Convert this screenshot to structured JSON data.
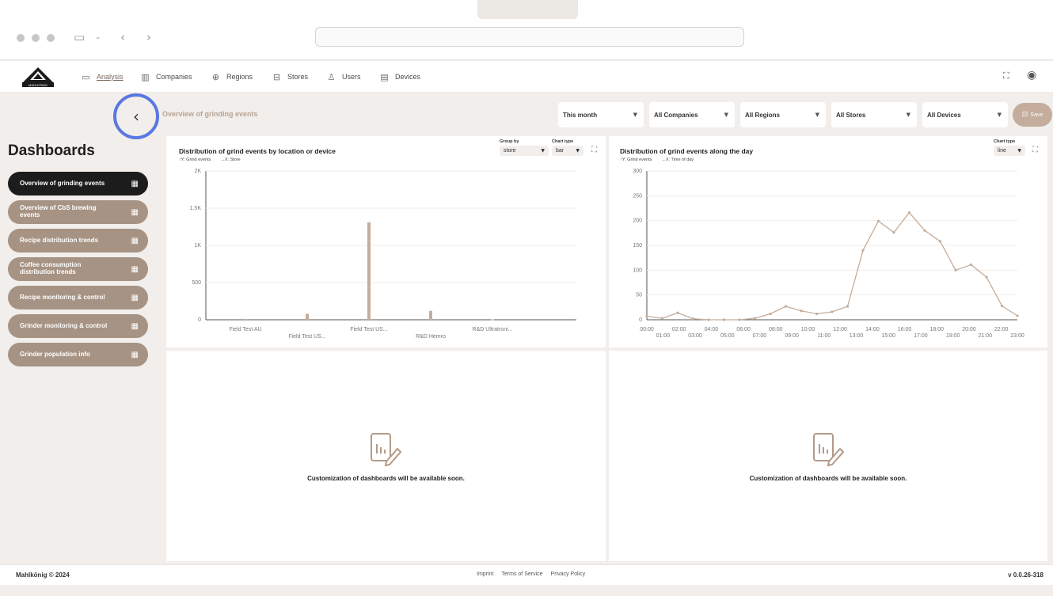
{
  "nav": {
    "logo_text": "MAHLKÖNIG",
    "items": [
      {
        "label": "Analysis",
        "icon": "analysis-icon"
      },
      {
        "label": "Companies",
        "icon": "building-icon"
      },
      {
        "label": "Regions",
        "icon": "globe-icon"
      },
      {
        "label": "Stores",
        "icon": "store-icon"
      },
      {
        "label": "Users",
        "icon": "users-icon"
      },
      {
        "label": "Devices",
        "icon": "device-icon"
      }
    ],
    "active": "Analysis"
  },
  "breadcrumb": "Overview of grinding events",
  "filters": {
    "period": "This month",
    "companies": "All Companies",
    "regions": "All Regions",
    "stores": "All Stores",
    "devices": "All Devices",
    "save_label": "Save"
  },
  "sidebar": {
    "title": "Dashboards",
    "items": [
      {
        "label": "Overview of grinding events",
        "active": true
      },
      {
        "label": "Overview of CbS brewing events"
      },
      {
        "label": "Recipe distribution trends"
      },
      {
        "label": "Coffee consumption distribution trends"
      },
      {
        "label": "Recipe monitoring & control"
      },
      {
        "label": "Grinder monitoring & control"
      },
      {
        "label": "Grinder population info"
      }
    ]
  },
  "panel1": {
    "title": "Distribution of grind events by location or device",
    "legend_y": "↑Y: Grind events",
    "legend_x": "→X: Store",
    "group_by_label": "Group by",
    "group_by_value": "store",
    "chart_type_label": "Chart type",
    "chart_type_value": "bar"
  },
  "panel2": {
    "title": "Distribution of grind events along the day",
    "legend_y": "↑Y: Grind events",
    "legend_x": "→X: Time of day",
    "chart_type_label": "Chart type",
    "chart_type_value": "line"
  },
  "soon_text": "Customization of dashboards will be available soon.",
  "footer": {
    "copyright": "Mahlkönig © 2024",
    "links": [
      "Imprint",
      "Terms of Service",
      "Privacy Policy"
    ],
    "version": "v 0.0.26-318"
  },
  "colors": {
    "accent": "#c4ad9c",
    "sidebar_item": "#a69384",
    "active": "#1c1c1c",
    "highlight_ring": "#5a78e0"
  },
  "chart_data": [
    {
      "type": "bar",
      "categories": [
        "Field Test AU",
        "Field Test US...",
        "Field Test US...",
        "R&D Hemro",
        "R&D Ultratroni..."
      ],
      "values": [
        10,
        80,
        1310,
        120,
        5
      ],
      "yticks": [
        "0",
        "500",
        "1K",
        "1.5K",
        "2K"
      ],
      "ylim": [
        0,
        2000
      ]
    },
    {
      "type": "line",
      "x": [
        "00:00",
        "01:00",
        "02:00",
        "03:00",
        "04:00",
        "05:00",
        "06:00",
        "07:00",
        "08:00",
        "09:00",
        "10:00",
        "11:00",
        "12:00",
        "13:00",
        "14:00",
        "15:00",
        "16:00",
        "17:00",
        "18:00",
        "19:00",
        "20:00",
        "21:00",
        "22:00",
        "23:00"
      ],
      "values": [
        7,
        3,
        14,
        2,
        0,
        0,
        0,
        3,
        12,
        27,
        18,
        12,
        16,
        27,
        140,
        199,
        176,
        216,
        180,
        158,
        100,
        111,
        86,
        28,
        8
      ],
      "yticks": [
        "0",
        "50",
        "100",
        "150",
        "200",
        "250",
        "300"
      ],
      "ylim": [
        0,
        300
      ]
    }
  ]
}
